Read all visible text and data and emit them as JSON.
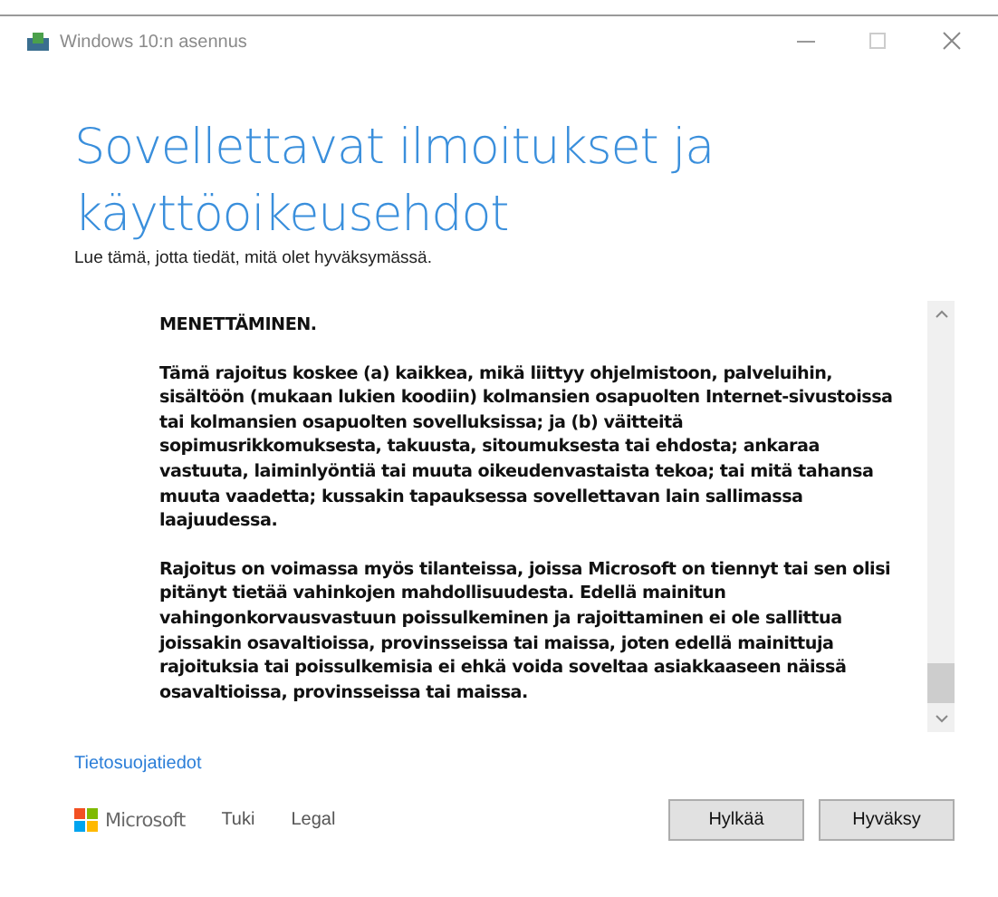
{
  "window": {
    "title": "Windows 10:n asennus"
  },
  "heading": "Sovellettavat ilmoitukset ja\nkäyttöoikeusehdot",
  "subtitle": "Lue tämä, jotta tiedät, mitä olet hyväksymässä.",
  "license": {
    "paragraphs": [
      "MENETTÄMINEN.",
      "Tämä rajoitus koskee (a) kaikkea, mikä liittyy ohjelmistoon, palveluihin,\nsisältöön (mukaan lukien koodiin) kolmansien osapuolten Internet-sivustoissa\ntai kolmansien osapuolten sovelluksissa; ja (b) väitteitä\nsopimusrikkomuksesta, takuusta, sitoumuksesta tai ehdosta; ankaraa\nvastuuta, laiminlyöntiä tai muuta oikeudenvastaista tekoa; tai mitä tahansa\nmuuta vaadetta; kussakin tapauksessa sovellettavan lain sallimassa\nlaajuudessa.",
      "Rajoitus on voimassa myös tilanteissa, joissa Microsoft on tiennyt tai sen olisi\npitänyt tietää vahinkojen mahdollisuudesta. Edellä mainitun\nvahingonkorvausvastuun poissulkeminen ja rajoittaminen ei ole sallittua\njoissakin osavaltioissa, provinsseissa tai maissa, joten edellä mainittuja\nrajoituksia tai poissulkemisia ei ehkä voida soveltaa asiakkaaseen näissä\nosavaltioissa, provinsseissa tai maissa."
    ]
  },
  "privacy_link": "Tietosuojatiedot",
  "footer": {
    "brand": "Microsoft",
    "links": [
      "Tuki",
      "Legal"
    ]
  },
  "buttons": [
    "Hylkää",
    "Hyväksy"
  ]
}
